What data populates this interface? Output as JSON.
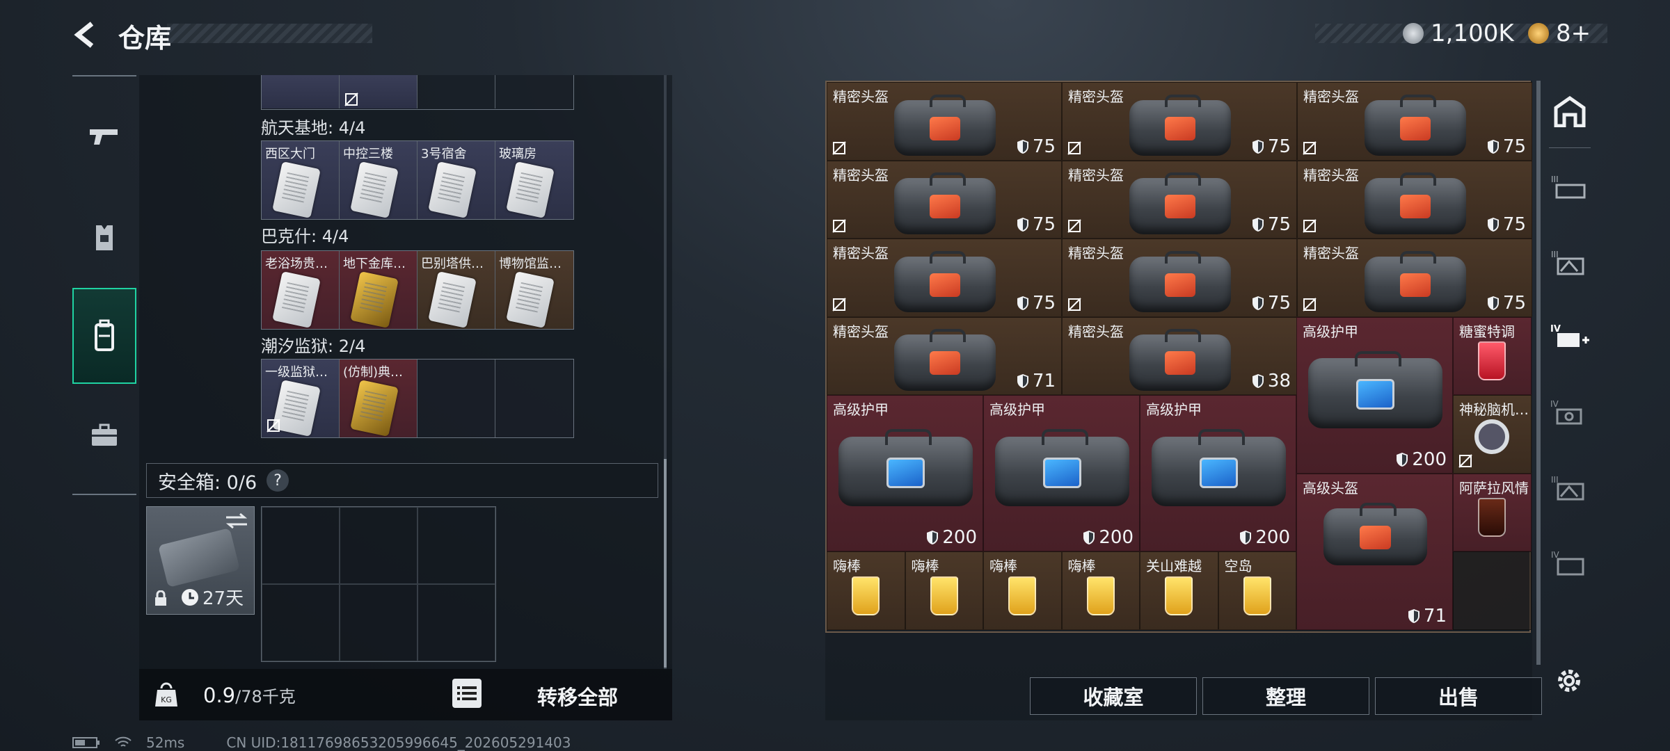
{
  "header": {
    "title": "仓库",
    "currency_silver": "1,100K",
    "currency_gold": "8+"
  },
  "left_panel": {
    "groups": [
      {
        "title": "航天基地: 4/4",
        "cards": [
          {
            "name": "西区大门",
            "tone": "blue",
            "card": "silver",
            "lock": false
          },
          {
            "name": "中控三楼",
            "tone": "blue",
            "card": "silver",
            "lock": false
          },
          {
            "name": "3号宿舍",
            "tone": "blue",
            "card": "silver",
            "lock": false
          },
          {
            "name": "玻璃房",
            "tone": "blue",
            "card": "silver",
            "lock": false
          }
        ]
      },
      {
        "title": "巴克什: 4/4",
        "cards": [
          {
            "name": "老浴场贵…",
            "tone": "red",
            "card": "silver",
            "lock": false
          },
          {
            "name": "地下金库…",
            "tone": "red",
            "card": "gold",
            "lock": false
          },
          {
            "name": "巴别塔供…",
            "tone": "gold",
            "card": "silver",
            "lock": false
          },
          {
            "name": "博物馆监…",
            "tone": "gold",
            "card": "silver",
            "lock": false
          }
        ]
      },
      {
        "title": "潮汐监狱: 2/4",
        "cards": [
          {
            "name": "一级监狱…",
            "tone": "blue",
            "card": "silver",
            "lock": true
          },
          {
            "name": "(仿制)典…",
            "tone": "red",
            "card": "gold",
            "lock": false
          },
          {
            "name": "",
            "tone": "empty",
            "card": "",
            "lock": false
          },
          {
            "name": "",
            "tone": "empty",
            "card": "",
            "lock": false
          }
        ]
      }
    ],
    "safe_label": "安全箱: 0/6",
    "safe_help": "?",
    "safe_timer": "27天",
    "weight_value": "0.9",
    "weight_max": "/78千克",
    "transfer_all": "转移全部"
  },
  "right_panel": {
    "helmets": [
      {
        "name": "精密头盔",
        "dura": "75"
      },
      {
        "name": "精密头盔",
        "dura": "75"
      },
      {
        "name": "精密头盔",
        "dura": "75"
      },
      {
        "name": "精密头盔",
        "dura": "75"
      },
      {
        "name": "精密头盔",
        "dura": "75"
      },
      {
        "name": "精密头盔",
        "dura": "75"
      },
      {
        "name": "精密头盔",
        "dura": "75"
      },
      {
        "name": "精密头盔",
        "dura": "75"
      },
      {
        "name": "精密头盔",
        "dura": "75"
      },
      {
        "name": "精密头盔",
        "dura": "71"
      },
      {
        "name": "精密头盔",
        "dura": "38"
      }
    ],
    "armor_big": {
      "name": "高级护甲",
      "dura": "200"
    },
    "drink_1": {
      "name": "糖蜜特调"
    },
    "device": {
      "name": "神秘脑机…"
    },
    "armors": [
      {
        "name": "高级护甲",
        "dura": "200"
      },
      {
        "name": "高级护甲",
        "dura": "200"
      },
      {
        "name": "高级护甲",
        "dura": "200"
      }
    ],
    "helmet_big": {
      "name": "高级头盔",
      "dura": "71"
    },
    "drink_2": {
      "name": "阿萨拉风情"
    },
    "small_drinks": [
      {
        "name": "嗨棒"
      },
      {
        "name": "嗨棒"
      },
      {
        "name": "嗨棒"
      },
      {
        "name": "嗨棒"
      },
      {
        "name": "关山难越"
      },
      {
        "name": "空岛"
      }
    ],
    "buttons": {
      "collection": "收藏室",
      "organize": "整理",
      "sell": "出售"
    }
  },
  "status": {
    "ping": "52ms",
    "uid": "CN UID:18117698653205996645_202605291403"
  },
  "colors": {
    "accent": "#1fd3a2",
    "brown_cell": "#3f2f22",
    "maroon_cell": "#4f2229"
  }
}
